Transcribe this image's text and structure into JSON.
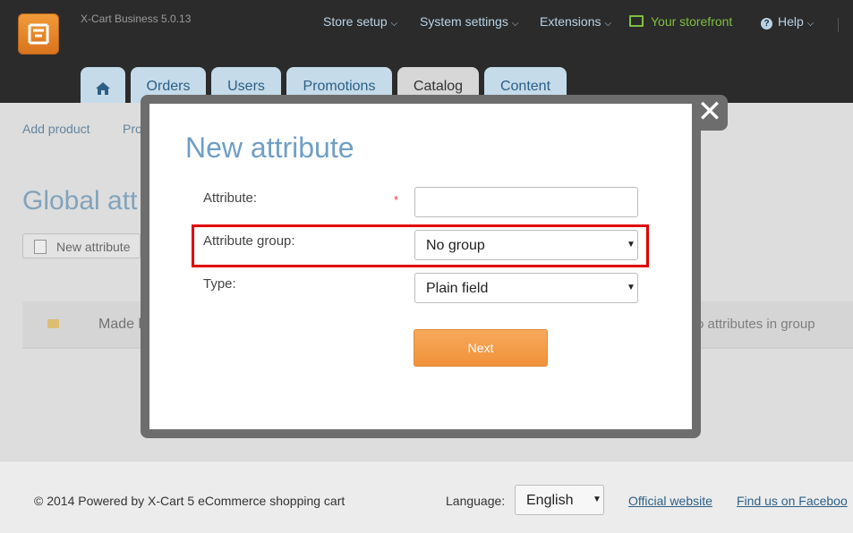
{
  "app": {
    "version": "X-Cart Business 5.0.13",
    "logo_icon": "xcart-logo-icon"
  },
  "topnav": [
    {
      "label": "Store setup"
    },
    {
      "label": "System settings"
    },
    {
      "label": "Extensions"
    },
    {
      "label": "Your storefront"
    },
    {
      "label": "Help"
    }
  ],
  "tabs": [
    {
      "label": ""
    },
    {
      "label": "Orders"
    },
    {
      "label": "Users"
    },
    {
      "label": "Promotions"
    },
    {
      "label": "Catalog"
    },
    {
      "label": "Content"
    }
  ],
  "subnav": {
    "add_product": "Add product",
    "partial": "Pro"
  },
  "page": {
    "title_partial": "Global att",
    "new_attribute_button": "New attribute",
    "group_row": {
      "name_partial": "Made b",
      "count_partial": "o attributes in group"
    }
  },
  "modal": {
    "title": "New attribute",
    "close_glyph": "✕",
    "fields": {
      "attribute_label": "Attribute:",
      "attribute_required": "*",
      "attribute_value": "",
      "group_label": "Attribute group:",
      "group_value": "No group",
      "type_label": "Type:",
      "type_value": "Plain field"
    },
    "next_button": "Next"
  },
  "footer": {
    "copyright": "© 2014 Powered by X-Cart 5 eCommerce shopping cart",
    "language_label": "Language:",
    "language_value": "English",
    "official_website": "Official website",
    "facebook": "Find us on Faceboo"
  },
  "colors": {
    "accent_blue": "#2d5f86",
    "next_orange": "#f0923a",
    "highlight_red": "#e00000",
    "storefront_green": "#7fbf3f"
  }
}
